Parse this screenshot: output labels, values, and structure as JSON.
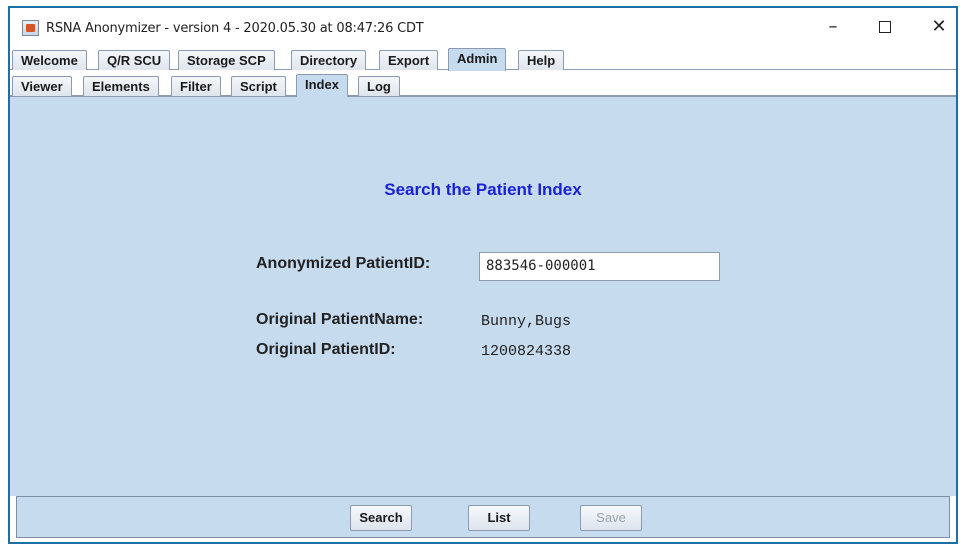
{
  "window": {
    "title": "RSNA Anonymizer - version 4 - 2020.05.30 at 08:47:26 CDT",
    "controls": {
      "minimize": "–",
      "close": "✕"
    }
  },
  "main_tabs": [
    "Welcome",
    "Q/R SCU",
    "Storage SCP",
    "Directory",
    "Export",
    "Admin",
    "Help"
  ],
  "main_tabs_active": "Admin",
  "sub_tabs": [
    "Viewer",
    "Elements",
    "Filter",
    "Script",
    "Index",
    "Log"
  ],
  "sub_tabs_active": "Index",
  "index_panel": {
    "heading": "Search the Patient Index",
    "anon_id_label": "Anonymized PatientID:",
    "anon_id_value": "883546-000001",
    "orig_name_label": "Original PatientName:",
    "orig_name_value": "Bunny,Bugs",
    "orig_id_label": "Original PatientID:",
    "orig_id_value": "1200824338"
  },
  "footer": {
    "search_label": "Search",
    "list_label": "List",
    "save_label": "Save"
  },
  "colors": {
    "panel_bg": "#c7dbef",
    "heading": "#1a22d6",
    "window_border": "#1d6fa8"
  }
}
